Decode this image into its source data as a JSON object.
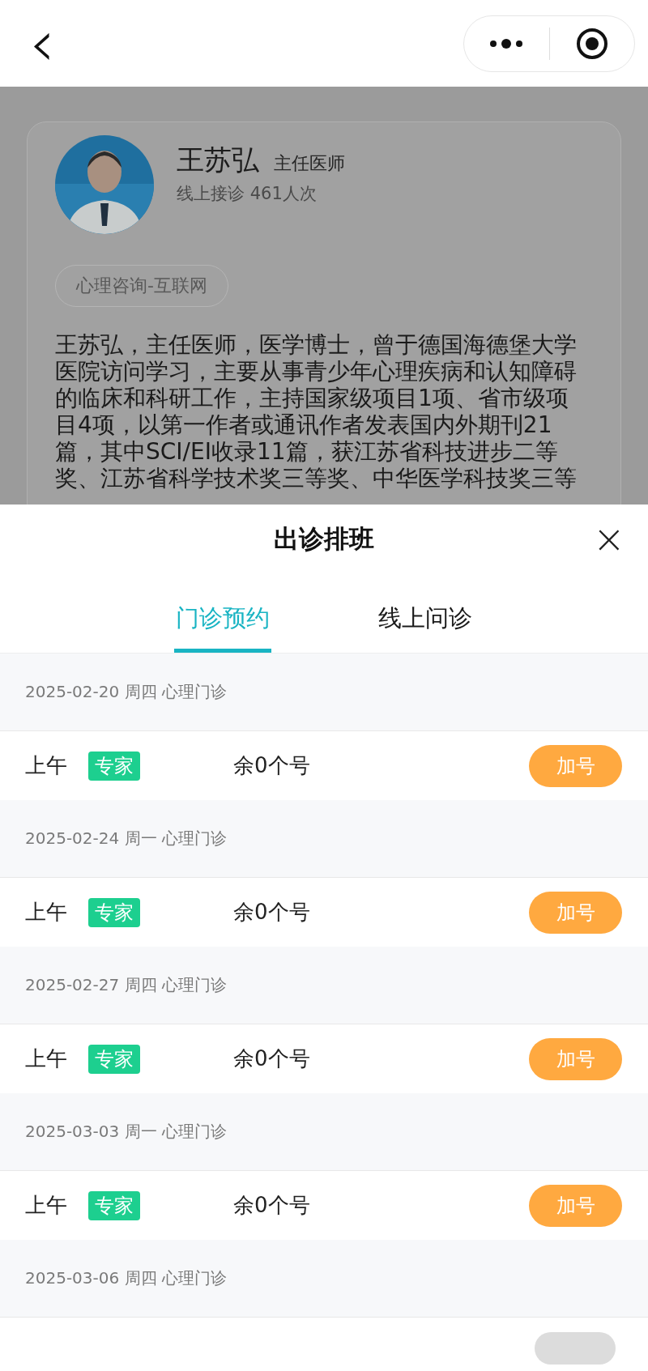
{
  "nav": {
    "back": "‹"
  },
  "doctor": {
    "name": "王苏弘",
    "title": "主任医师",
    "consults": "线上接诊 461人次",
    "tag": "心理咨询-互联网",
    "bio": "王苏弘，主任医师，医学博士，曾于德国海德堡大学医院访问学习，主要从事青少年心理疾病和认知障碍的临床和科研工作，主持国家级项目1项、省市级项目4项，以第一作者或通讯作者发表国内外期刊21篇，其中SCI/EI收录11篇，获江苏省科技进步二等奖、江苏省科学技术奖三等奖、中华医学科技奖三等"
  },
  "sheet": {
    "title": "出诊排班",
    "close": "×",
    "tabs": [
      {
        "label": "门诊预约",
        "selected": true
      },
      {
        "label": "线上问诊",
        "selected": false
      }
    ],
    "days": [
      {
        "date": "2025-02-20 周四 心理门诊",
        "slots": [
          {
            "period": "上午",
            "tag": "专家",
            "remaining": "余0个号",
            "action": "加号"
          }
        ]
      },
      {
        "date": "2025-02-24 周一 心理门诊",
        "slots": [
          {
            "period": "上午",
            "tag": "专家",
            "remaining": "余0个号",
            "action": "加号"
          }
        ]
      },
      {
        "date": "2025-02-27 周四 心理门诊",
        "slots": [
          {
            "period": "上午",
            "tag": "专家",
            "remaining": "余0个号",
            "action": "加号"
          }
        ]
      },
      {
        "date": "2025-03-03 周一 心理门诊",
        "slots": [
          {
            "period": "上午",
            "tag": "专家",
            "remaining": "余0个号",
            "action": "加号"
          }
        ]
      },
      {
        "date": "2025-03-06 周四 心理门诊"
      }
    ]
  }
}
